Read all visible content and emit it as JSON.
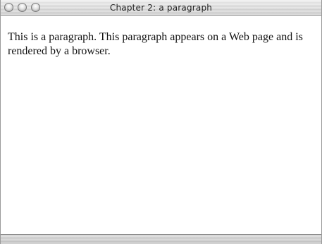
{
  "window": {
    "title": "Chapter 2: a paragraph",
    "traffic_lights": [
      "close-button",
      "minimize-button",
      "zoom-button"
    ]
  },
  "content": {
    "paragraph": "This is a paragraph. This paragraph appears on a Web page and is rendered by a browser."
  },
  "colors": {
    "background": "#ffffff",
    "text": "#111111",
    "titlebar": "#dcdcdc"
  }
}
